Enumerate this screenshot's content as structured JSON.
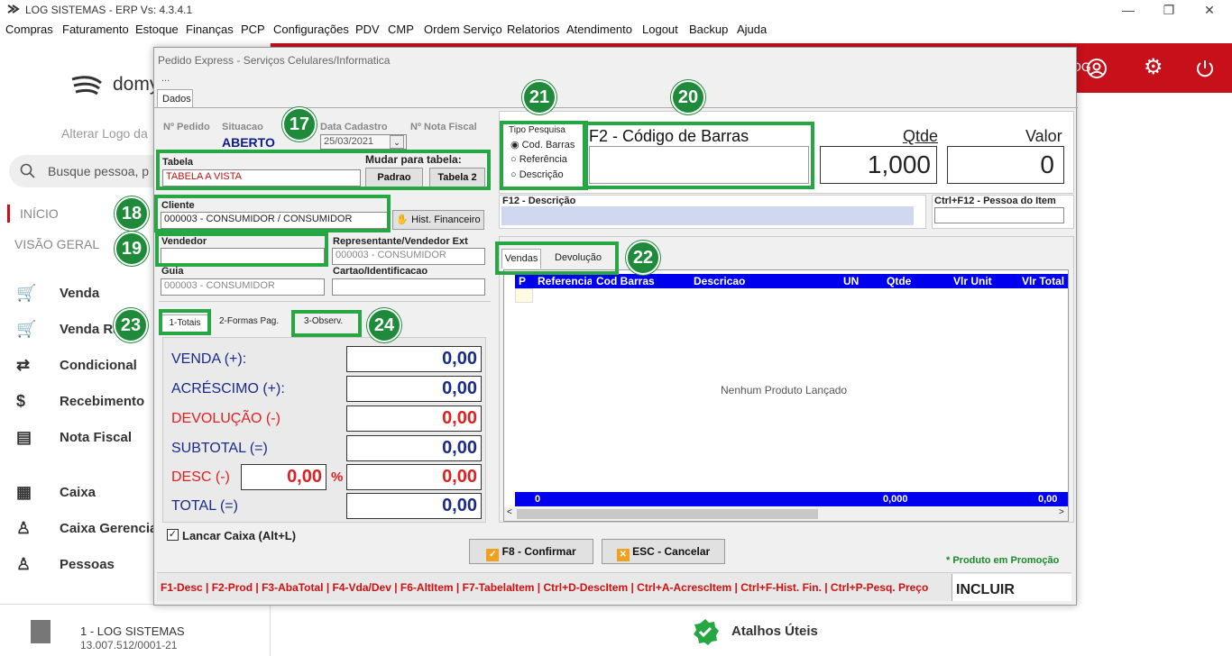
{
  "window": {
    "title": "LOG SISTEMAS - ERP Vs: 4.3.4.1",
    "controls": [
      "—",
      "❐",
      "✕"
    ]
  },
  "menu": [
    "Compras",
    "Faturamento",
    "Estoque",
    "Finanças",
    "PCP",
    "Configurações",
    "PDV",
    "CMP",
    "Ordem Serviço",
    "Relatorios",
    "Atendimento",
    "Logout",
    "Backup",
    "Ajuda"
  ],
  "bg": {
    "logo_text": "domy",
    "alter_logo": "Alterar Logo da",
    "search_placeholder": "Busque pessoa, p",
    "inicio": "INÍCIO",
    "visao_geral": "VISÃO GERAL",
    "items": [
      "Venda",
      "Venda Ra",
      "Condicional",
      "Recebimento",
      "Nota Fiscal",
      "Caixa",
      "Caixa Gerencia",
      "Pessoas"
    ],
    "company": "1 - LOG SISTEMAS",
    "cnpj": "13.007.512/0001-21",
    "header_user": "OG",
    "atalhos": "Atalhos Úteis"
  },
  "dialog": {
    "title": "Pedido Express - Serviços Celulares/Informatica",
    "ellipsis": "...",
    "tab": "Dados",
    "no_pedido": "Nº Pedido",
    "situacao_lbl": "Situacao",
    "situacao": "ABERTO",
    "data_cad_lbl": "Data Cadastro",
    "data_cad": "25/03/2021",
    "nota_lbl": "Nº Nota Fiscal",
    "tabela_lbl": "Tabela",
    "tabela": "TABELA A VISTA",
    "mudar_lbl": "Mudar para tabela:",
    "padrao": "Padrao",
    "tabela2": "Tabela 2",
    "cliente_lbl": "Cliente",
    "cliente": "000003 - CONSUMIDOR / CONSUMIDOR",
    "hist": "Hist. Financeiro",
    "vendedor_lbl": "Vendedor",
    "vendedor": "",
    "rep_lbl": "Representante/Vendedor Ext",
    "rep": "000003 - CONSUMIDOR",
    "guia_lbl": "Guia",
    "guia": "000003 - CONSUMIDOR",
    "cartao_lbl": "Cartao/Identificacao",
    "cartao": "",
    "tabs_bottom": [
      "1-Totais",
      "2-Formas Pag.",
      "3-Observ."
    ],
    "totals": {
      "venda_lbl": "VENDA (+):",
      "venda": "0,00",
      "acres_lbl": "ACRÉSCIMO (+):",
      "acres": "0,00",
      "dev_lbl": "DEVOLUÇÃO (-)",
      "dev": "0,00",
      "sub_lbl": "SUBTOTAL (=)",
      "sub": "0,00",
      "desc_lbl": "DESC (-)",
      "desc_pct": "0,00",
      "pct": "%",
      "desc": "0,00",
      "total_lbl": "TOTAL  (=)",
      "total": "0,00"
    },
    "lancar": "Lancar Caixa (Alt+L)",
    "tipo_lbl": "Tipo Pesquisa",
    "tipo_opts": [
      "Cod. Barras",
      "Referência",
      "Descrição"
    ],
    "barcode_lbl": "F2 - Código de Barras",
    "qtde_lbl": "Qtde",
    "qtde": "1,000",
    "valor_lbl": "Valor",
    "valor": "0",
    "f12_lbl": "F12 - Descrição",
    "ctrlf12_lbl": "Ctrl+F12 - Pessoa do Item",
    "grid_tabs": [
      "Vendas",
      "Devolução"
    ],
    "grid_cols": [
      "P",
      "Referencia",
      "Cod Barras",
      "Descricao",
      "UN",
      "Qtde",
      "Vlr Unit",
      "Vlr Total"
    ],
    "grid_empty": "Nenhum Produto Lançado",
    "foot_count": "0",
    "foot_qtde": "0,000",
    "foot_total": "0,00",
    "confirm": "F8 - Confirmar",
    "cancel": "ESC - Cancelar",
    "promo": "* Produto em Promoção",
    "shortcuts": "F1-Desc | F2-Prod | F3-AbaTotal | F4-Vda/Dev | F6-AltItem | F7-TabelaItem | Ctrl+D-DescItem | Ctrl+A-AcrescItem | Ctrl+F-Hist. Fin. | Ctrl+P-Pesq. Preço",
    "incluir": "INCLUIR"
  },
  "badges": [
    "17",
    "18",
    "19",
    "20",
    "21",
    "22",
    "23",
    "24"
  ],
  "colors": {
    "red": "#c8101b",
    "green": "#27a744",
    "blue": "#0000cc",
    "navy": "#1a2a8a"
  }
}
